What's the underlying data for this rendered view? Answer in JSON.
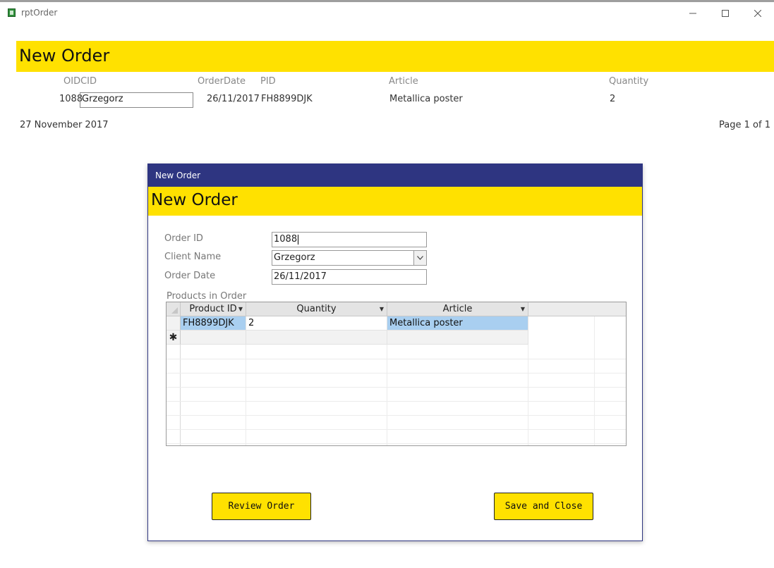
{
  "window": {
    "title": "rptOrder"
  },
  "report": {
    "title": "New Order",
    "columns": [
      "OIDCID",
      "OrderDate",
      "PID",
      "Article",
      "Quantity"
    ],
    "row": {
      "oid": "1088",
      "client": "Grzegorz",
      "order_date": "26/11/2017",
      "pid": "FH8899DJK",
      "article": "Metallica poster",
      "quantity": "2"
    },
    "footer": {
      "date": "27 November 2017",
      "page": "Page 1 of 1"
    }
  },
  "dialog": {
    "window_title": "New Order",
    "header_title": "New Order",
    "fields": {
      "order_id": {
        "label": "Order ID",
        "value": "1088"
      },
      "client_name": {
        "label": "Client Name",
        "value": "Grzegorz"
      },
      "order_date": {
        "label": "Order Date",
        "value": "26/11/2017"
      }
    },
    "subform": {
      "label": "Products in Order",
      "columns": [
        "Product ID",
        "Quantity",
        "Article"
      ],
      "rows": [
        {
          "product_id": "FH8899DJK",
          "quantity": "2",
          "article": "Metallica poster"
        }
      ],
      "new_row_marker": "✱"
    },
    "buttons": {
      "review": "Review Order",
      "save_close": "Save and Close"
    }
  },
  "colors": {
    "header_yellow": "#ffe100",
    "dialog_titlebar": "#2e3581",
    "row_highlight": "#a9cff0"
  },
  "icons": [
    "app-icon",
    "minimize-icon",
    "maximize-icon",
    "close-icon",
    "dropdown-arrow-icon",
    "new-record-icon"
  ]
}
